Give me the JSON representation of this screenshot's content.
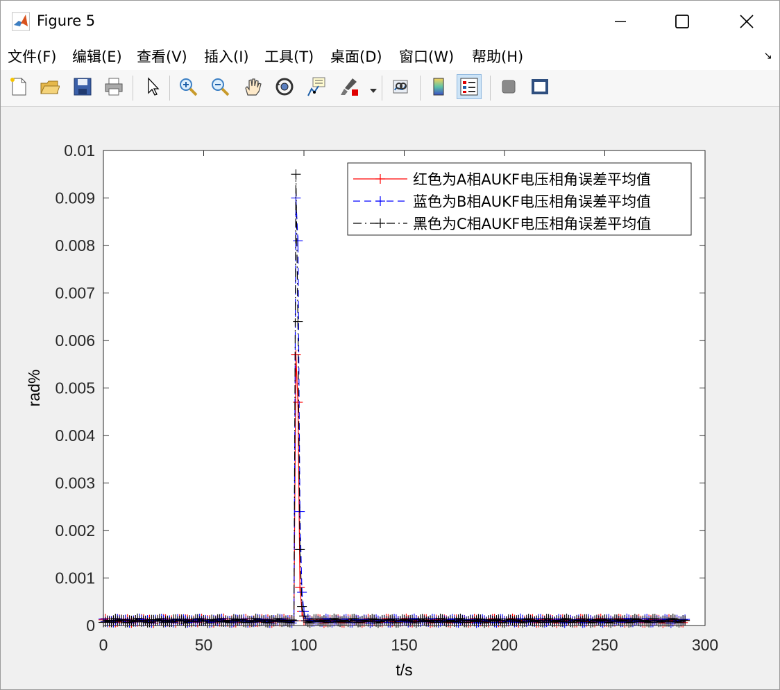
{
  "window": {
    "title": "Figure 5"
  },
  "menubar": {
    "items": [
      {
        "label": "文件(F)",
        "name": "menu-file"
      },
      {
        "label": "编辑(E)",
        "name": "menu-edit"
      },
      {
        "label": "查看(V)",
        "name": "menu-view"
      },
      {
        "label": "插入(I)",
        "name": "menu-insert"
      },
      {
        "label": "工具(T)",
        "name": "menu-tools"
      },
      {
        "label": "桌面(D)",
        "name": "menu-desktop"
      },
      {
        "label": "窗口(W)",
        "name": "menu-window"
      },
      {
        "label": "帮助(H)",
        "name": "menu-help"
      }
    ],
    "dock_arrow": "↘"
  },
  "toolbar": {
    "icons": [
      "new-figure-icon",
      "open-file-icon",
      "save-icon",
      "print-icon",
      "select-pointer-icon",
      "zoom-in-icon",
      "zoom-out-icon",
      "pan-icon",
      "rotate-3d-icon",
      "data-cursor-icon",
      "brush-icon",
      "link-plot-icon",
      "colorbar-icon",
      "legend-icon",
      "hide-plot-tools-icon",
      "show-plot-tools-icon"
    ],
    "active": "legend-icon"
  },
  "chart_data": {
    "type": "line",
    "xlabel": "t/s",
    "ylabel": "rad%",
    "xlim": [
      0,
      300
    ],
    "ylim": [
      0,
      0.01
    ],
    "xticks": [
      0,
      50,
      100,
      150,
      200,
      250,
      300
    ],
    "yticks": [
      0,
      0.001,
      0.002,
      0.003,
      0.004,
      0.005,
      0.006,
      0.007,
      0.008,
      0.009,
      0.01
    ],
    "xtick_labels": [
      "0",
      "50",
      "100",
      "150",
      "200",
      "250",
      "300"
    ],
    "ytick_labels": [
      "0",
      "0.001",
      "0.002",
      "0.003",
      "0.004",
      "0.005",
      "0.006",
      "0.007",
      "0.008",
      "0.009",
      "0.01"
    ],
    "legend_position": "top-right",
    "grid": false,
    "baseline_value": 0.0001,
    "baseline_x_range": [
      0,
      290
    ],
    "series": [
      {
        "name": "红色为A相AUKF电压相角误差平均值",
        "color": "#ff0000",
        "linestyle": "solid",
        "marker": "+",
        "peak_x": [
          95,
          96,
          97,
          98,
          99,
          100,
          101
        ],
        "peak_y": [
          0.0001,
          0.0057,
          0.0047,
          0.0008,
          0.0003,
          0.0001,
          0.0001
        ]
      },
      {
        "name": "蓝色为B相AUKF电压相角误差平均值",
        "color": "#0000ff",
        "linestyle": "dashed",
        "marker": "+",
        "peak_x": [
          95,
          96,
          97,
          98,
          99,
          100,
          101
        ],
        "peak_y": [
          0.0001,
          0.009,
          0.0081,
          0.0024,
          0.0007,
          0.0003,
          0.0001
        ]
      },
      {
        "name": "黑色为C相AUKF电压相角误差平均值",
        "color": "#000000",
        "linestyle": "dashdot",
        "marker": "+",
        "peak_x": [
          95,
          96,
          97,
          98,
          99,
          100,
          101
        ],
        "peak_y": [
          0.0001,
          0.0095,
          0.0064,
          0.0016,
          0.0004,
          0.0002,
          0.0001
        ]
      }
    ]
  }
}
